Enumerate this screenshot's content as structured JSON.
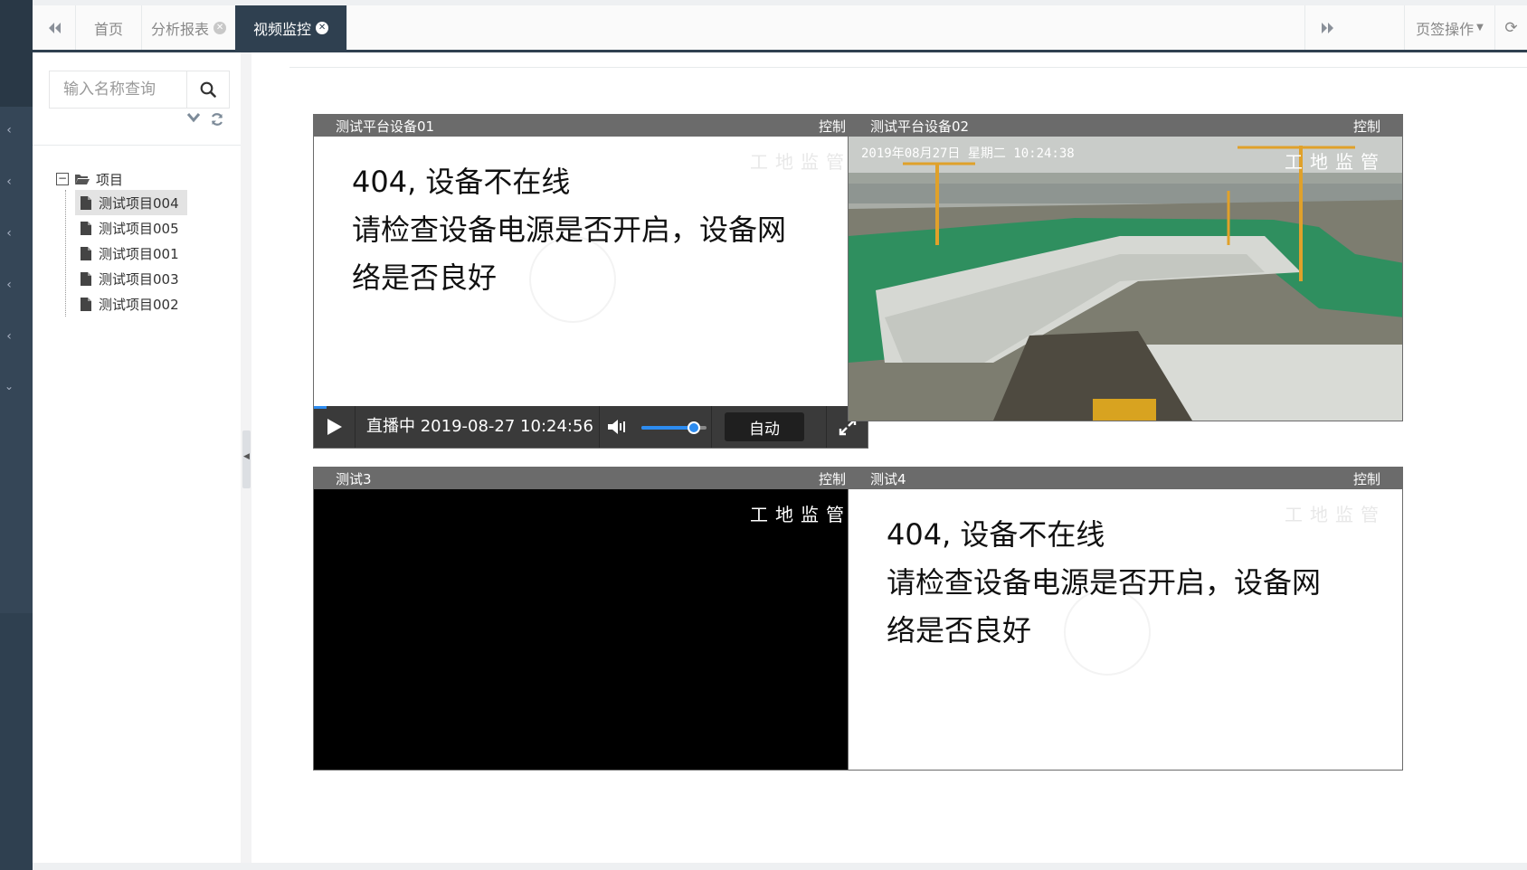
{
  "tabs": {
    "items": [
      {
        "label": "首页",
        "closable": false,
        "active": false
      },
      {
        "label": "分析报表",
        "closable": true,
        "active": false
      },
      {
        "label": "视频监控",
        "closable": true,
        "active": true
      }
    ],
    "page_ops_label": "页签操作"
  },
  "sidebar": {
    "search_placeholder": "输入名称查询",
    "tree": {
      "root_label": "项目",
      "children": [
        {
          "label": "测试项目004",
          "selected": true
        },
        {
          "label": "测试项目005",
          "selected": false
        },
        {
          "label": "测试项目001",
          "selected": false
        },
        {
          "label": "测试项目003",
          "selected": false
        },
        {
          "label": "测试项目002",
          "selected": false
        }
      ]
    }
  },
  "videos": [
    {
      "title": "测试平台设备01",
      "control_label": "控制",
      "watermark": "工地监管",
      "message_line1": "404, 设备不在线",
      "message_line2": "请检查设备电源是否开启，设备网络是否良好",
      "player": {
        "status": "直播中 2019-08-27 10:24:56",
        "quality": "自动",
        "volume": 0.8
      }
    },
    {
      "title": "测试平台设备02",
      "control_label": "控制",
      "watermark": "工地监管",
      "osd_text": "2019年08月27日 星期二 10:24:38"
    },
    {
      "title": "测试3",
      "control_label": "控制",
      "watermark": "工地监管"
    },
    {
      "title": "测试4",
      "control_label": "控制",
      "watermark": "工地监管",
      "message_line1": "404, 设备不在线",
      "message_line2": "请检查设备电源是否开启，设备网络是否良好"
    }
  ],
  "colors": {
    "nav_dark": "#2f4050",
    "active_tab": "#2f4050",
    "video_header": "#6b6b6b",
    "player_accent": "#2d8cf0"
  }
}
